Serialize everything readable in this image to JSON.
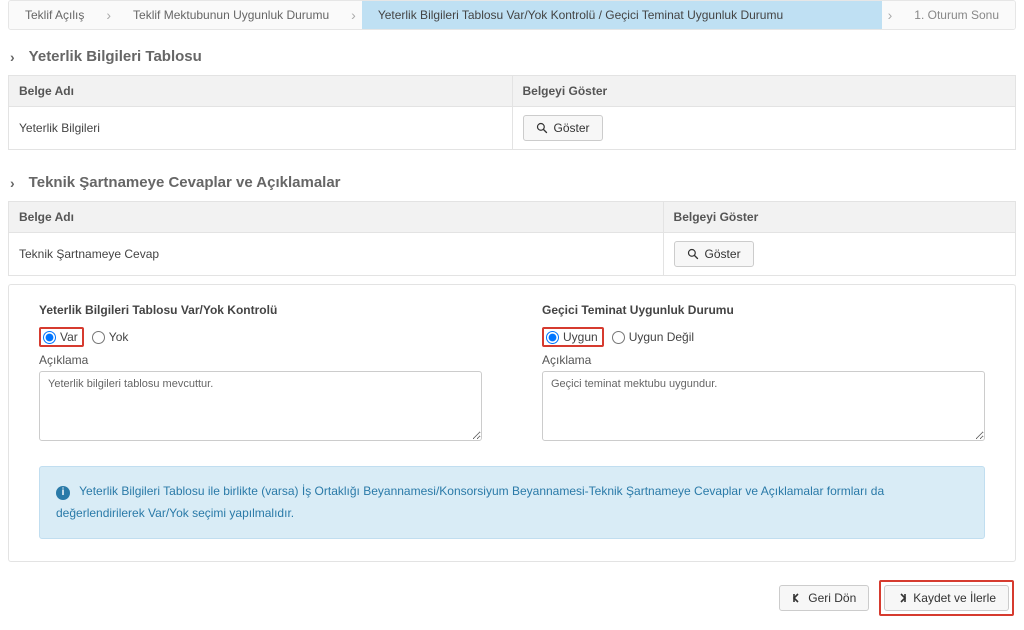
{
  "breadcrumb": {
    "items": [
      {
        "label": "Teklif Açılış"
      },
      {
        "label": "Teklif Mektubunun Uygunluk Durumu"
      },
      {
        "label": "Yeterlik Bilgileri Tablosu Var/Yok Kontrolü / Geçici Teminat Uygunluk Durumu",
        "active": true
      },
      {
        "label": "1. Oturum Sonu"
      }
    ]
  },
  "section1": {
    "title": "Yeterlik Bilgileri Tablosu",
    "columns": {
      "name": "Belge Adı",
      "show": "Belgeyi Göster"
    },
    "row": {
      "name": "Yeterlik Bilgileri",
      "button": "Göster"
    }
  },
  "section2": {
    "title": "Teknik Şartnameye Cevaplar ve Açıklamalar",
    "columns": {
      "name": "Belge Adı",
      "show": "Belgeyi Göster"
    },
    "row": {
      "name": "Teknik Şartnameye Cevap",
      "button": "Göster"
    }
  },
  "form": {
    "left": {
      "title": "Yeterlik Bilgileri Tablosu Var/Yok Kontrolü",
      "opt1": "Var",
      "opt2": "Yok",
      "explain_label": "Açıklama",
      "explain_value": "Yeterlik bilgileri tablosu mevcuttur."
    },
    "right": {
      "title": "Geçici Teminat Uygunluk Durumu",
      "opt1": "Uygun",
      "opt2": "Uygun Değil",
      "explain_label": "Açıklama",
      "explain_value": "Geçici teminat mektubu uygundur."
    }
  },
  "info": {
    "text": "Yeterlik Bilgileri Tablosu ile birlikte (varsa) İş Ortaklığı Beyannamesi/Konsorsiyum Beyannamesi-Teknik Şartnameye Cevaplar ve Açıklamalar formları da değerlendirilerek Var/Yok seçimi yapılmalıdır."
  },
  "footer": {
    "back": "Geri Dön",
    "save_next": "Kaydet ve İlerle"
  }
}
